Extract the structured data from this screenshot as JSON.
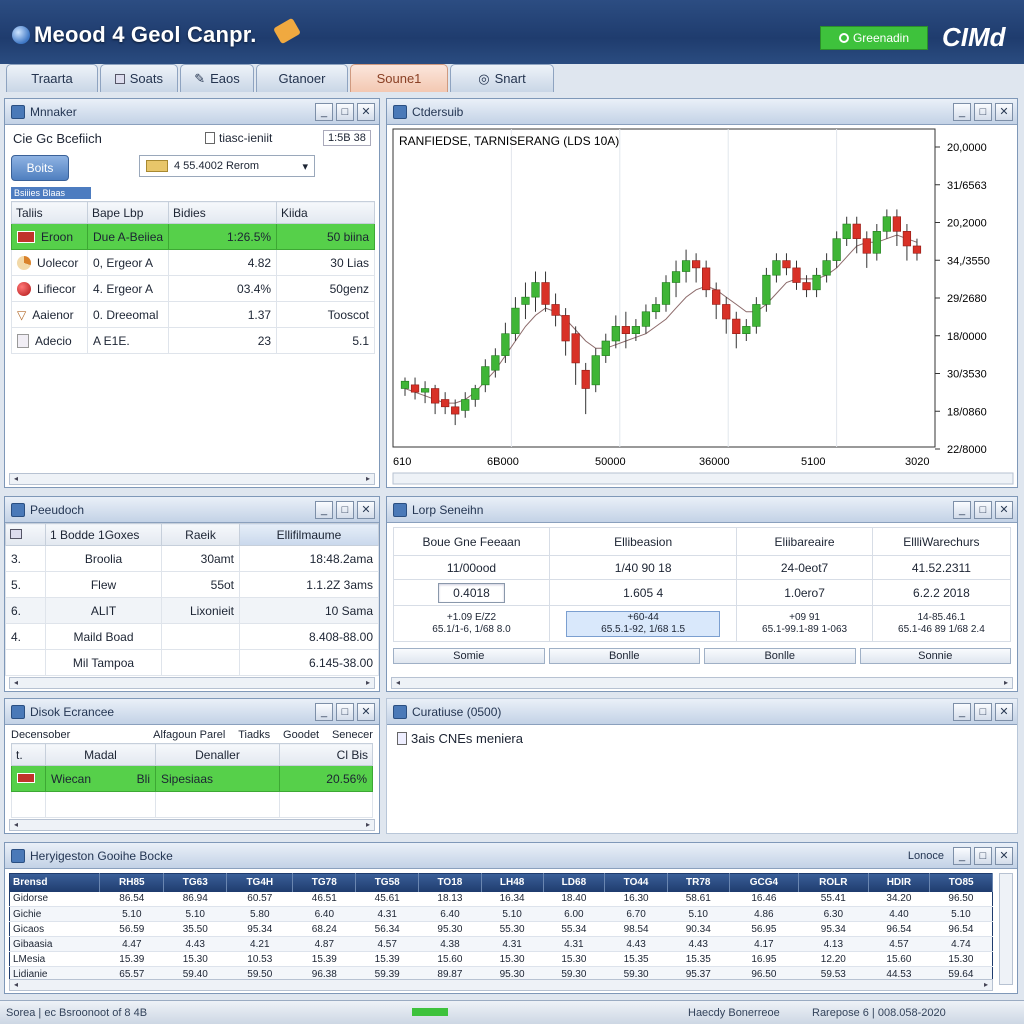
{
  "app": {
    "title": "Meood 4 Geol Canpr.",
    "status_label": "Greenadin",
    "brand": "CIMd"
  },
  "tabs": [
    {
      "label": "Traarta"
    },
    {
      "label": "Soats"
    },
    {
      "label": "Eaos"
    },
    {
      "label": "Gtanoer"
    },
    {
      "label": "Soune1"
    },
    {
      "label": "Snart"
    }
  ],
  "watch": {
    "title": "Mnnaker",
    "search_label": "Cie Gc Bcefiich",
    "result_label": "tiasc-ieniit",
    "counter": "1:5B 38",
    "button": "Boits",
    "combo_value": "4 55.4002 Rerom",
    "section_tag": "Bsiiies Blaas",
    "columns": [
      "Taliis",
      "Bape Lbp",
      "Bidies",
      "Kiida"
    ],
    "rows": [
      {
        "icon": "flag-icon",
        "name": "Eroon",
        "desc": "Due A-Beiiea",
        "value": "1:26.5%",
        "extra": "50 biina"
      },
      {
        "icon": "pie-icon",
        "name": "Uolecor",
        "desc": "0, Ergeor A",
        "value": "4.82",
        "extra": "30 Lias"
      },
      {
        "icon": "apple-icon",
        "name": "Lifiecor",
        "desc": "4. Ergeor A",
        "value": "03.4%",
        "extra": "50genz"
      },
      {
        "icon": "cup-icon",
        "name": "Aaienor",
        "desc": "0. Dreeomal",
        "value": "1.37",
        "extra": "Tooscot"
      },
      {
        "icon": "doc-icon",
        "name": "Adecio",
        "desc": "A E1E.",
        "value": "23",
        "extra": "5.1"
      }
    ]
  },
  "chart_panel": {
    "title": "Ctdersuib"
  },
  "chart_data": {
    "type": "candlestick",
    "title": "RANFIEDSE, TARNISERANG (LDS 10A)",
    "y_ticks": [
      "20,0000",
      "31/6563",
      "20,2000",
      "34,/3550",
      "29/2680",
      "18/0000",
      "30/3530",
      "18/0860",
      "22/8000"
    ],
    "x_ticks": [
      "610",
      "6B000",
      "50000",
      "36000",
      "5100",
      "3020"
    ],
    "grid": true,
    "candles": [
      [
        95,
        97,
        93,
        98
      ],
      [
        96,
        94,
        92,
        98
      ],
      [
        94,
        95,
        91,
        97
      ],
      [
        95,
        91,
        88,
        96
      ],
      [
        92,
        90,
        88,
        94
      ],
      [
        90,
        88,
        85,
        92
      ],
      [
        89,
        92,
        87,
        94
      ],
      [
        92,
        95,
        90,
        96
      ],
      [
        96,
        101,
        94,
        103
      ],
      [
        100,
        104,
        98,
        106
      ],
      [
        104,
        110,
        102,
        113
      ],
      [
        110,
        117,
        108,
        120
      ],
      [
        118,
        120,
        114,
        124
      ],
      [
        120,
        124,
        116,
        127
      ],
      [
        124,
        118,
        116,
        127
      ],
      [
        118,
        115,
        112,
        121
      ],
      [
        115,
        108,
        104,
        117
      ],
      [
        110,
        102,
        96,
        112
      ],
      [
        100,
        95,
        88,
        102
      ],
      [
        96,
        104,
        94,
        106
      ],
      [
        104,
        108,
        102,
        110
      ],
      [
        108,
        112,
        106,
        115
      ],
      [
        112,
        110,
        106,
        116
      ],
      [
        110,
        112,
        108,
        114
      ],
      [
        112,
        116,
        110,
        118
      ],
      [
        116,
        118,
        114,
        120
      ],
      [
        118,
        124,
        116,
        126
      ],
      [
        124,
        127,
        120,
        130
      ],
      [
        127,
        130,
        124,
        133
      ],
      [
        130,
        128,
        124,
        132
      ],
      [
        128,
        122,
        120,
        130
      ],
      [
        122,
        118,
        114,
        124
      ],
      [
        118,
        114,
        110,
        120
      ],
      [
        114,
        110,
        106,
        116
      ],
      [
        110,
        112,
        108,
        114
      ],
      [
        112,
        118,
        110,
        120
      ],
      [
        118,
        126,
        116,
        128
      ],
      [
        126,
        130,
        124,
        132
      ],
      [
        130,
        128,
        126,
        132
      ],
      [
        128,
        124,
        122,
        130
      ],
      [
        124,
        122,
        120,
        126
      ],
      [
        122,
        126,
        120,
        128
      ],
      [
        126,
        130,
        124,
        132
      ],
      [
        130,
        136,
        128,
        138
      ],
      [
        136,
        140,
        134,
        142
      ],
      [
        140,
        136,
        132,
        142
      ],
      [
        136,
        132,
        128,
        138
      ],
      [
        132,
        138,
        130,
        140
      ],
      [
        138,
        142,
        136,
        144
      ],
      [
        142,
        138,
        134,
        144
      ],
      [
        138,
        134,
        130,
        140
      ],
      [
        134,
        132,
        130,
        136
      ]
    ],
    "ma_line": [
      95,
      94,
      93,
      92,
      91,
      91,
      92,
      94,
      97,
      100,
      104,
      108,
      112,
      115,
      117,
      116,
      114,
      111,
      108,
      106,
      106,
      107,
      108,
      109,
      110,
      112,
      114,
      117,
      120,
      122,
      123,
      122,
      120,
      118,
      116,
      116,
      118,
      121,
      124,
      125,
      125,
      125,
      126,
      128,
      131,
      134,
      135,
      135,
      136,
      137,
      136,
      135
    ]
  },
  "positions": {
    "title": "Peeudoch",
    "columns": [
      "1 Bodde 1Goxes",
      "Raeik",
      "Ellifilmaume"
    ],
    "rows": [
      {
        "c0": "3.",
        "c1": "Broolia",
        "c2": "30amt",
        "c3": "18:48.2ama"
      },
      {
        "c0": "5.",
        "c1": "Flew",
        "c2": "55ot",
        "c3": "1.1.2Z 3ams"
      },
      {
        "c0": "6.",
        "c1": "ALIT",
        "c2": "Lixonieit",
        "c3": "10 Sama"
      },
      {
        "c0": "4.",
        "c1": "Maild Boad",
        "c2": "",
        "c3": "8.408-88.00"
      },
      {
        "c0": "",
        "c1": "Mil Tampoa",
        "c2": "",
        "c3": "6.145-38.00"
      }
    ]
  },
  "quotes": {
    "title": "Lorp Seneihn",
    "columns": [
      "Boue Gne Feeaan",
      "Ellibeasion",
      "Eliibareaire",
      "EllliWarechurs"
    ],
    "row1": [
      "11/00ood",
      "1/40 90 18",
      "24-0eot7",
      "41.52.2311"
    ],
    "row2": [
      "0.4018",
      "1.605 4",
      "1.0ero7",
      "6.2.2 2018"
    ],
    "row3_top": [
      "+1.09 E/Z2",
      "+60-44",
      "+09 91",
      "14-85.46.1"
    ],
    "row3_bottom": [
      "65.1/1-6, 1/68 8.0",
      "65.5.1-92, 1/68 1.5",
      "65.1-99.1-89 1-063",
      "65.1-46 89 1/68 2.4"
    ],
    "actions": [
      "Somie",
      "Bonlle",
      "Bonlle",
      "Sonnie"
    ]
  },
  "orders": {
    "title": "Disok Ecrancee",
    "header_cols": [
      "Decensober",
      "Alfagoun Parel",
      "Tiadks",
      "Goodet",
      "Senecer"
    ],
    "sub_cols": [
      "t.",
      "Madal",
      "Denaller",
      "Cl Bis"
    ],
    "row": {
      "name": "Wiecan",
      "b": "Bli",
      "c": "Sipesiaas",
      "d": "20.56%"
    }
  },
  "notes": {
    "title": "Curatiuse (0500)",
    "text": "3ais CNEs meniera"
  },
  "market": {
    "title": "Heryigeston Gooihe Bocke",
    "title_right": "Lonoce",
    "columns": [
      "Brensd",
      "RH85",
      "TG63",
      "TG4H",
      "TG78",
      "TG58",
      "TO18",
      "LH48",
      "LD68",
      "TO44",
      "TR78",
      "GCG4",
      "ROLR",
      "HDIR",
      "TO85"
    ],
    "rows": [
      [
        "Gidorse",
        "86.54",
        "86.94",
        "60.57",
        "46.51",
        "45.61",
        "18.13",
        "16.34",
        "18.40",
        "16.30",
        "58.61",
        "16.46",
        "55.41",
        "34.20",
        "96.50"
      ],
      [
        "Gichie",
        "5.10",
        "5.10",
        "5.80",
        "6.40",
        "4.31",
        "6.40",
        "5.10",
        "6.00",
        "6.70",
        "5.10",
        "4.86",
        "6.30",
        "4.40",
        "5.10"
      ],
      [
        "Gicaos",
        "56.59",
        "35.50",
        "95.34",
        "68.24",
        "56.34",
        "95.30",
        "55.30",
        "55.34",
        "98.54",
        "90.34",
        "56.95",
        "95.34",
        "96.54",
        "96.54"
      ],
      [
        "Gibaasia",
        "4.47",
        "4.43",
        "4.21",
        "4.87",
        "4.57",
        "4.38",
        "4.31",
        "4.31",
        "4.43",
        "4.43",
        "4.17",
        "4.13",
        "4.57",
        "4.74"
      ],
      [
        "LMesia",
        "15.39",
        "15.30",
        "10.53",
        "15.39",
        "15.39",
        "15.60",
        "15.30",
        "15.30",
        "15.35",
        "15.35",
        "16.95",
        "12.20",
        "15.60",
        "15.30"
      ],
      [
        "Lidianie",
        "65.57",
        "59.40",
        "59.50",
        "96.38",
        "59.39",
        "89.87",
        "95.30",
        "59.30",
        "59.30",
        "95.37",
        "96.50",
        "59.53",
        "44.53",
        "59.64"
      ]
    ]
  },
  "statusbar": {
    "left": "Sorea | ec Bsroonoot of 8 4B",
    "middle": "Haecdy Bonerreoe",
    "right": "Rarepose 6 | 008.058-2020"
  }
}
